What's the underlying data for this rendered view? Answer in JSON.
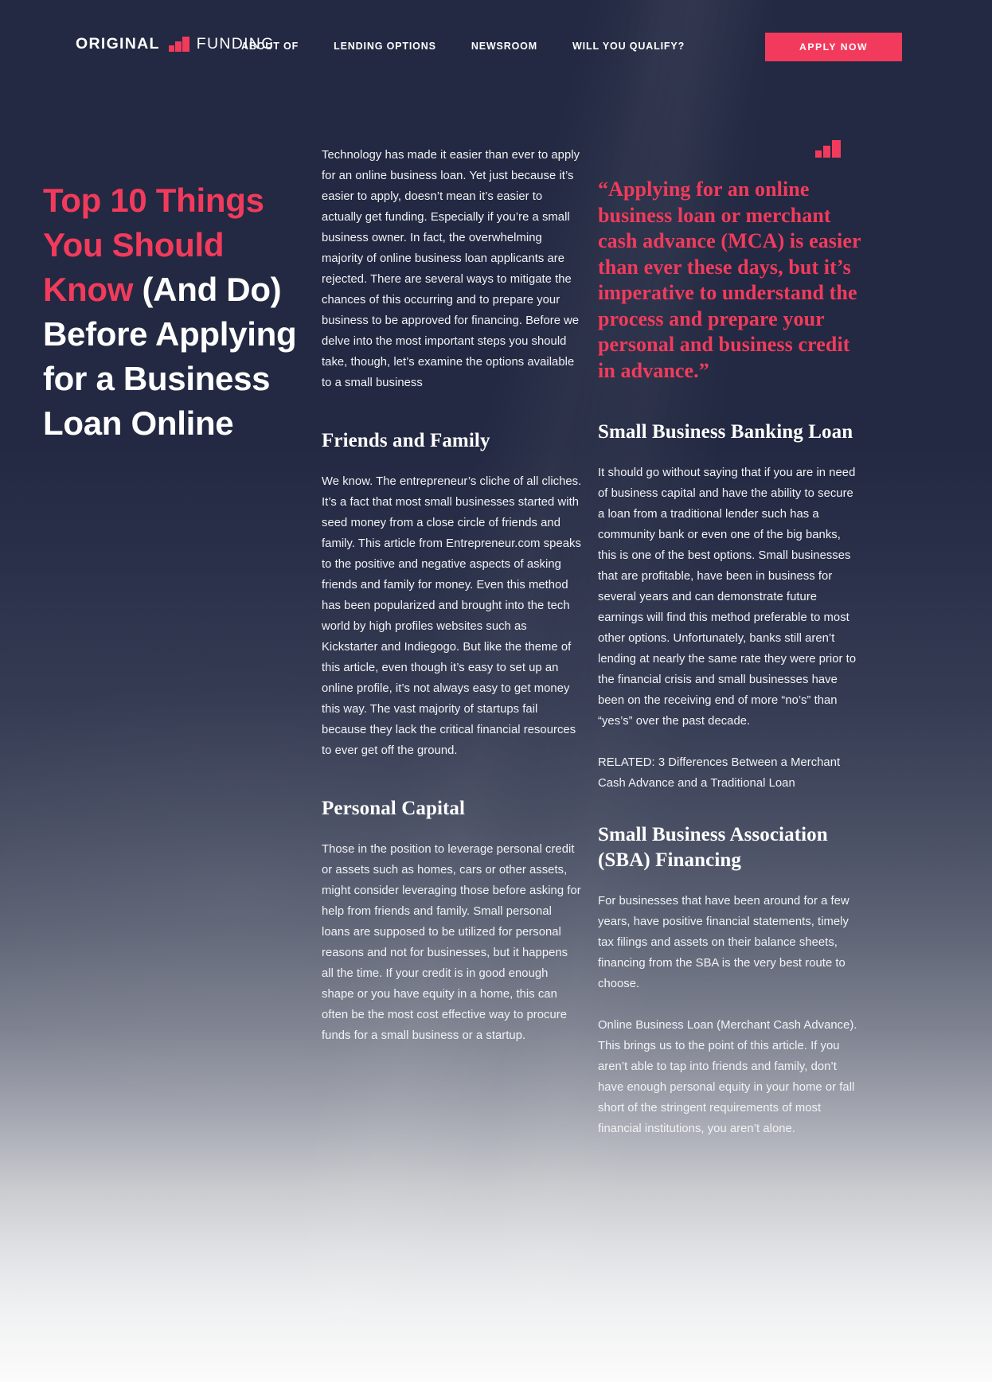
{
  "brand": {
    "word1": "ORIGINAL",
    "word2": "FUNDING",
    "mark": "bar-chart-mark",
    "accent_color": "#f23b5c",
    "background_color": "#232942"
  },
  "nav": {
    "items": [
      {
        "label": "ABOUT OF"
      },
      {
        "label": "LENDING OPTIONS"
      },
      {
        "label": "NEWSROOM"
      },
      {
        "label": "WILL YOU QUALIFY?"
      }
    ],
    "cta_label": "APPLY NOW"
  },
  "article": {
    "headline_red": "Top 10 Things You Should Know",
    "headline_white": " (And Do) Before Applying for a Business Loan Online",
    "intro": "Technology has made it easier than ever to apply for an online business loan. Yet just because it’s easier to apply, doesn’t mean it’s easier to actually get funding. Especially if you’re a small business owner. In fact, the overwhelming majority of online business loan applicants are rejected. There are several ways to mitigate the chances of this occurring and to prepare your business to be approved for financing. Before we delve into the most important steps you should take, though, let’s examine the options available to a small business",
    "pullquote": "“Applying for an online business loan or merchant cash advance (MCA) is easier than ever these days, but it’s imperative to understand the process and prepare your personal and business credit in advance.”",
    "sections": {
      "friends_family": {
        "heading": "Friends and Family",
        "body": "We know. The entrepreneur’s cliche of all cliches. It’s a fact that most small businesses started with seed money from a close circle of friends and family. This article from Entrepreneur.com speaks to the positive and negative aspects of asking friends and family for money. Even this method has been popularized and brought into the tech world by high profiles websites such as Kickstarter and Indiegogo. But like the theme of this article, even though it’s easy to set up an online profile, it’s not always easy to get money this way. The vast majority of startups fail because they lack the critical financial resources to ever get off the ground."
      },
      "personal_capital": {
        "heading": "Personal Capital",
        "body": "Those in the position to leverage personal credit or assets such as homes, cars or other assets, might consider leveraging those before asking for help from friends and family. Small personal loans are supposed to be utilized for personal reasons and not for businesses, but it happens all the time. If your credit is in good enough shape or you have equity in a home, this can often be the most cost effective way to procure funds for a small business or a startup."
      },
      "banking_loan": {
        "heading": "Small Business Banking Loan",
        "body": "It should go without saying that if you are in need of business capital and have the ability to secure a loan from a traditional lender such has a community bank or even one of the big banks, this is one of the best options. Small businesses that are profitable, have been in business for several years and can demonstrate future earnings will find this method preferable to most other options. Unfortunately, banks still aren’t lending at nearly the same rate they were prior to the financial crisis and small businesses have been on the receiving end of more “no’s” than “yes’s” over the past decade."
      },
      "related": {
        "label": "RELATED: 3 Differences Between a Merchant Cash Advance and a Traditional Loan"
      },
      "sba": {
        "heading": "Small Business Association (SBA) Financing",
        "body": "For businesses that have been around for a few years, have positive financial statements, timely tax filings and assets on their balance sheets, financing from the SBA is the very best route to choose."
      },
      "online_loan": {
        "body": "Online Business Loan (Merchant Cash Advance). This brings us to the point of this article. If you aren’t able to tap into friends and family, don’t have enough personal equity in your home or fall short of the stringent requirements of most financial institutions, you aren’t alone."
      }
    }
  }
}
